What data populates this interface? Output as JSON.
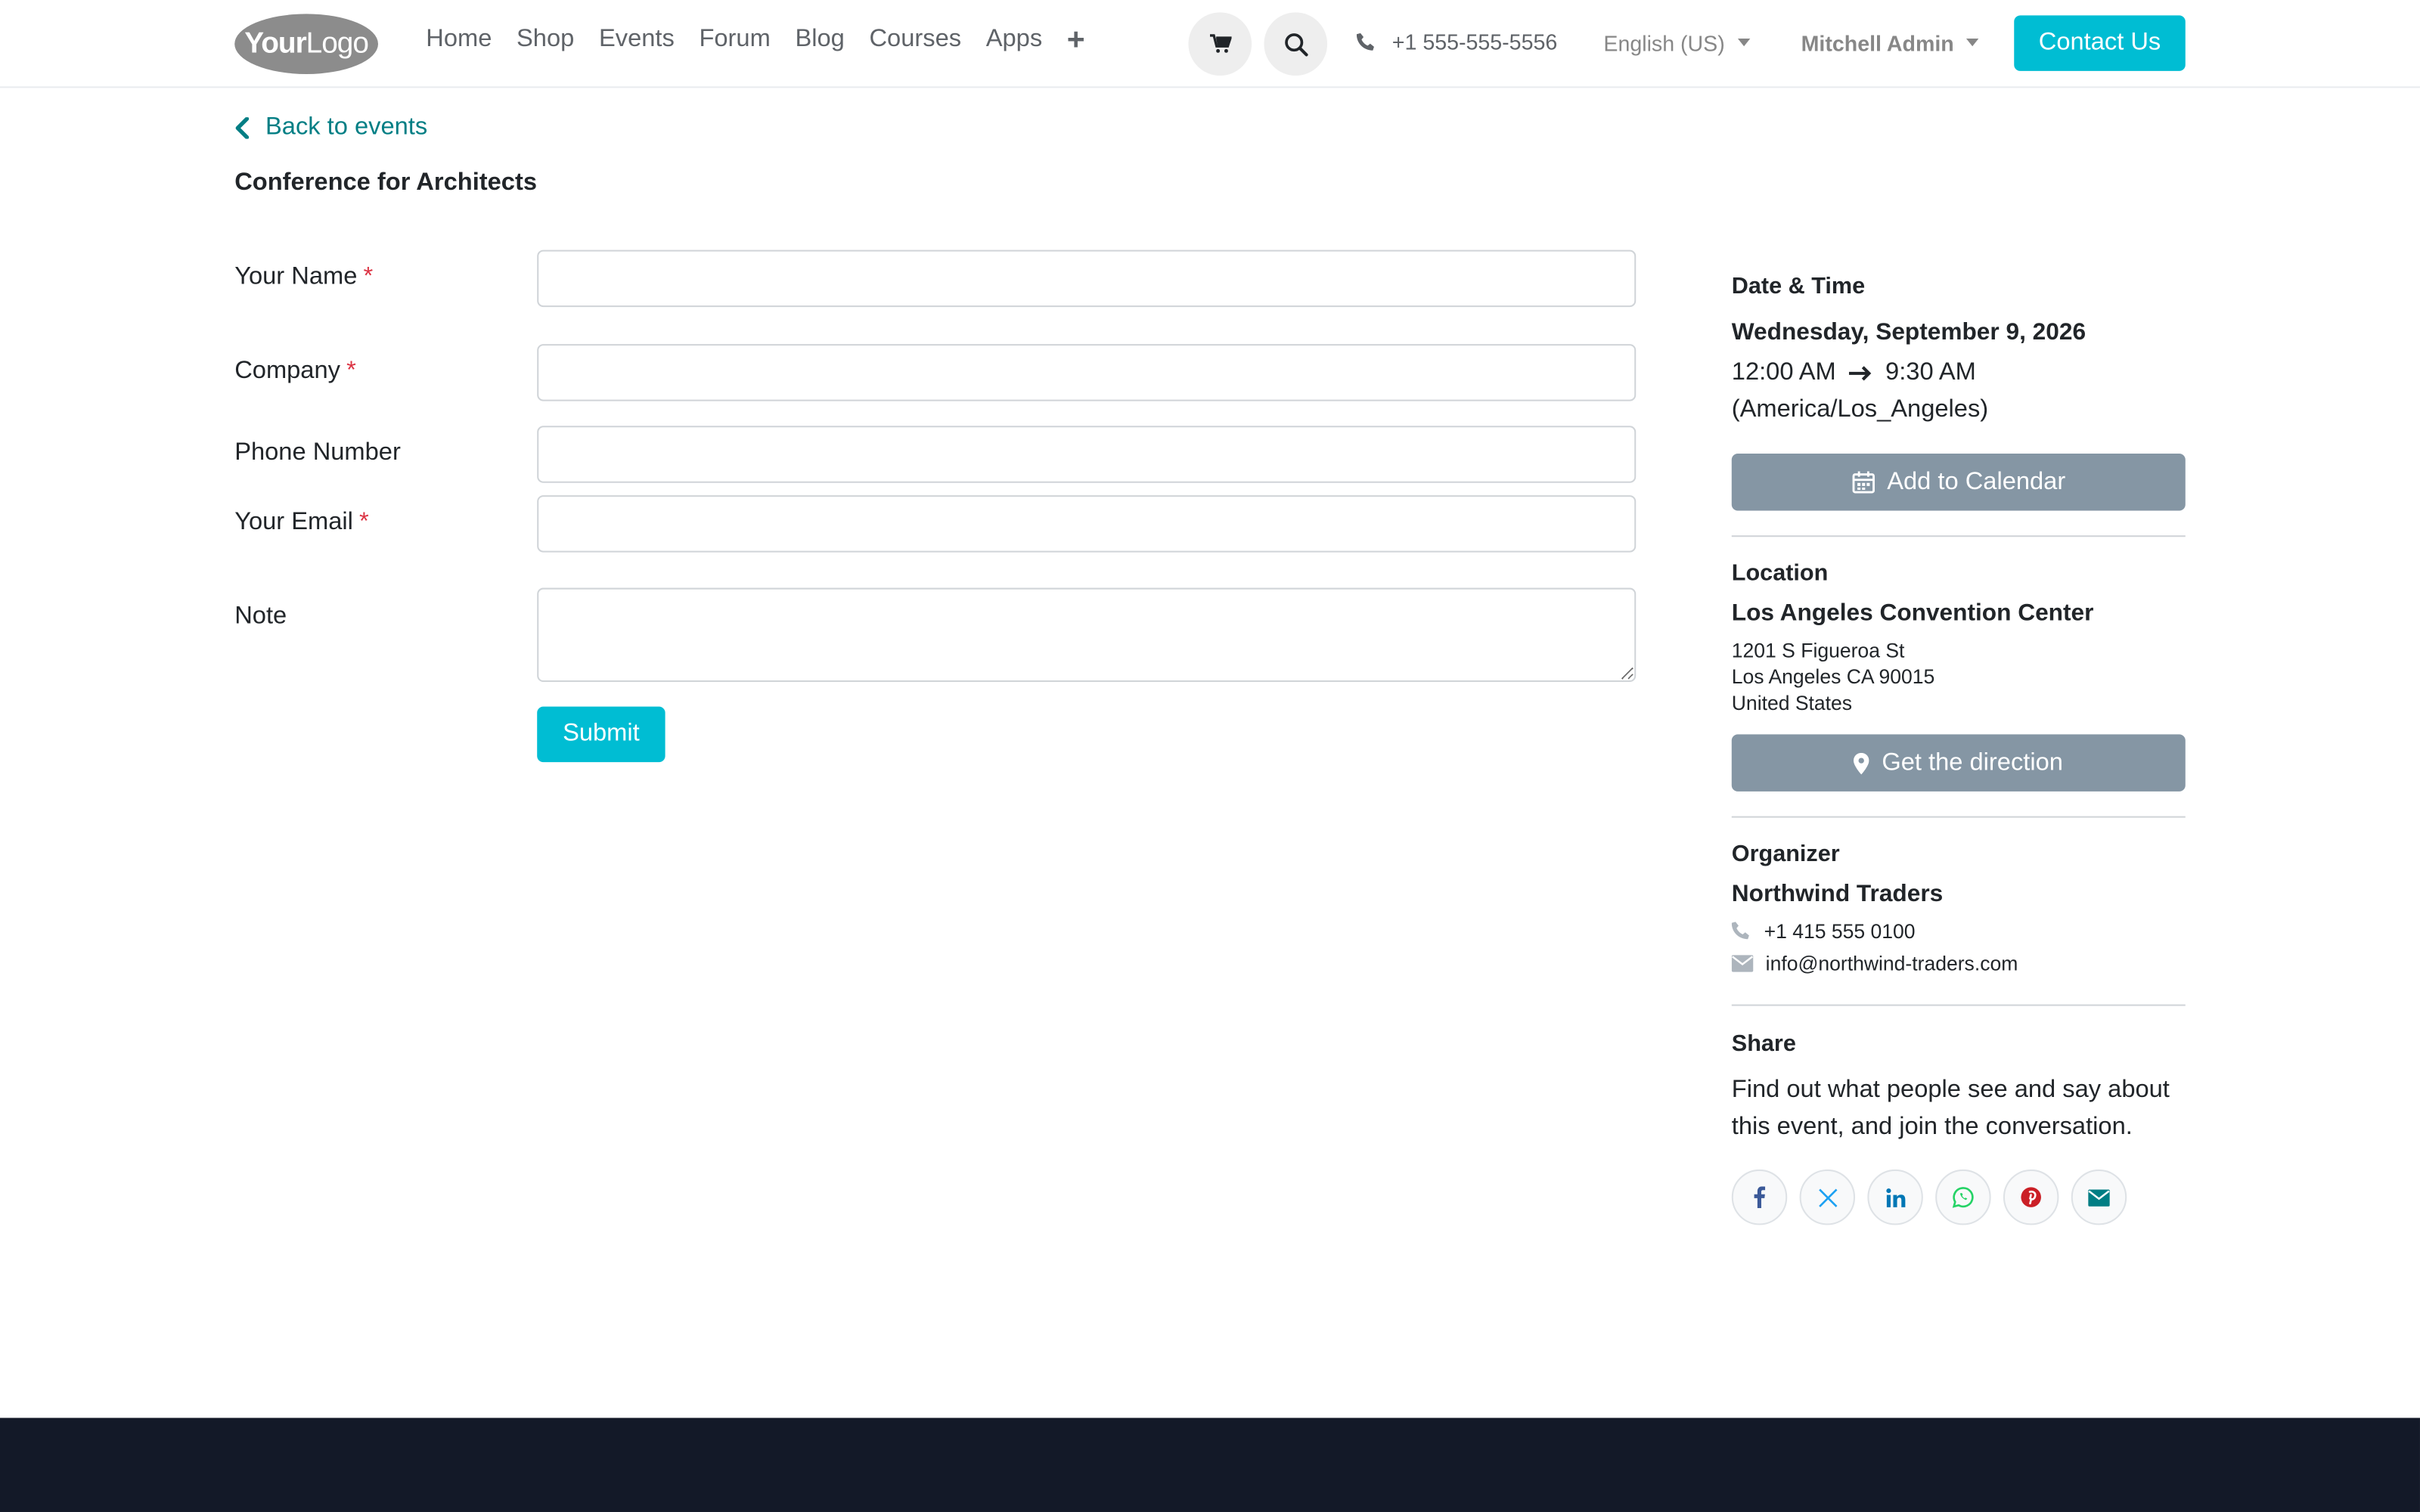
{
  "header": {
    "logo_bold": "Your",
    "logo_light": "Logo",
    "nav": [
      "Home",
      "Shop",
      "Events",
      "Forum",
      "Blog",
      "Courses",
      "Apps"
    ],
    "phone": "+1 555-555-5556",
    "language": "English (US)",
    "user": "Mitchell Admin",
    "contact_label": "Contact Us"
  },
  "page": {
    "back_label": "Back to events",
    "event_title": "Conference for Architects"
  },
  "form": {
    "name_label": "Your Name",
    "company_label": "Company",
    "phone_label": "Phone Number",
    "email_label": "Your Email",
    "note_label": "Note",
    "required_mark": "*",
    "submit_label": "Submit"
  },
  "sidebar": {
    "datetime_heading": "Date & Time",
    "date": "Wednesday, September 9, 2026",
    "start_time": "12:00 AM",
    "end_time": "9:30 AM",
    "timezone": "(America/Los_Angeles)",
    "calendar_label": "Add to Calendar",
    "location_heading": "Location",
    "venue": "Los Angeles Convention Center",
    "address_line1": "1201 S Figueroa St",
    "address_line2": "Los Angeles CA 90015",
    "address_line3": "United States",
    "direction_label": "Get the direction",
    "organizer_heading": "Organizer",
    "organizer_name": "Northwind Traders",
    "organizer_phone": "+1 415 555 0100",
    "organizer_email": "info@northwind-traders.com",
    "share_heading": "Share",
    "share_text": "Find out what people see and say about this event, and join the conversation."
  },
  "colors": {
    "accent": "#00bdd3",
    "link": "#017e84",
    "secondary_button": "#8596a4",
    "footer": "#131928",
    "required": "#dc3545"
  },
  "social_icons": [
    "facebook-icon",
    "x-twitter-icon",
    "linkedin-icon",
    "whatsapp-icon",
    "pinterest-icon",
    "envelope-icon"
  ]
}
